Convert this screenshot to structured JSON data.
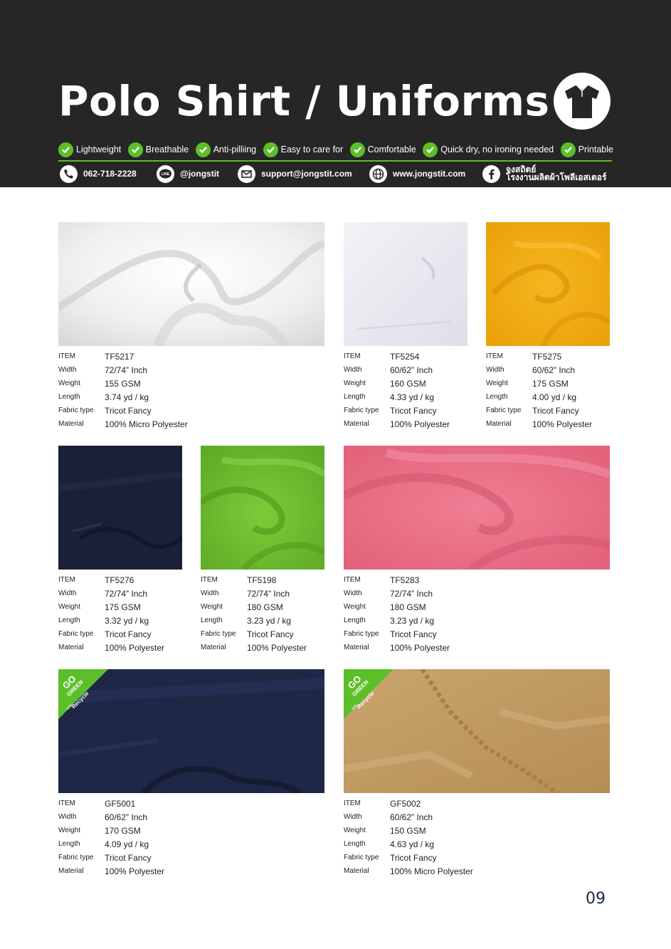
{
  "header": {
    "title": "Polo Shirt / Uniforms",
    "icon": "polo-shirt-icon",
    "features": [
      {
        "label": "Lightweight",
        "icon": "check-icon"
      },
      {
        "label": "Breathable",
        "icon": "check-icon"
      },
      {
        "label": "Anti-pilliing",
        "icon": "check-icon"
      },
      {
        "label": "Easy to care for",
        "icon": "check-icon"
      },
      {
        "label": "Comfortable",
        "icon": "check-icon"
      },
      {
        "label": "Quick dry, no ironing needed",
        "icon": "check-icon"
      },
      {
        "label": "Printable",
        "icon": "check-icon"
      }
    ],
    "contacts": {
      "phone": "062-718-2228",
      "line": "@jongstit",
      "line_badge": "LINE",
      "email": "support@jongstit.com",
      "website": "www.jongstit.com",
      "facebook_line1": "จงสถิตย์",
      "facebook_line2": "โรงงานผลิตผ้าโพลีเอสเตอร์"
    }
  },
  "colors": {
    "header_bg": "#262626",
    "accent_green": "#5cbf2a",
    "page_number": "#1a2744"
  },
  "spec_labels": {
    "item": "ITEM",
    "width": "Width",
    "weight": "Weight",
    "length": "Length",
    "fabric_type": "Fabric type",
    "material": "Material"
  },
  "go_green_badge": {
    "go": "GO",
    "green": "GREEN",
    "with": "with",
    "recycle": "Recycle"
  },
  "products": [
    {
      "item": "TF5217",
      "width": "72/74” Inch",
      "weight": "155 GSM",
      "length": "3.74 yd / kg",
      "fabric_type": "Tricot Fancy",
      "material": "100% Micro Polyester",
      "color": "#ececec"
    },
    {
      "item": "TF5254",
      "width": "60/62” Inch",
      "weight": "160 GSM",
      "length": "4.33 yd / kg",
      "fabric_type": "Tricot Fancy",
      "material": "100% Polyester",
      "color": "#e6e6ee"
    },
    {
      "item": "TF5275",
      "width": "60/62” Inch",
      "weight": "175 GSM",
      "length": "4.00 yd / kg",
      "fabric_type": "Tricot Fancy",
      "material": "100% Polyester",
      "color": "#f4b016"
    },
    {
      "item": "TF5276",
      "width": "72/74” Inch",
      "weight": "175 GSM",
      "length": "3.32 yd / kg",
      "fabric_type": "Tricot Fancy",
      "material": "100% Polyester",
      "color": "#1a2038"
    },
    {
      "item": "TF5198",
      "width": "72/74” Inch",
      "weight": "180 GSM",
      "length": "3.23 yd / kg",
      "fabric_type": "Tricot Fancy",
      "material": "100% Polyester",
      "color": "#6fbc2f"
    },
    {
      "item": "TF5283",
      "width": "72/74” Inch",
      "weight": "180 GSM",
      "length": "3.23 yd / kg",
      "fabric_type": "Tricot Fancy",
      "material": "100% Polyester",
      "color": "#ea7086"
    },
    {
      "item": "GF5001",
      "width": "60/62” Inch",
      "weight": "170 GSM",
      "length": "4.09 yd / kg",
      "fabric_type": "Tricot Fancy",
      "material": "100% Polyester",
      "color": "#1f2747",
      "badge": "go-green-recycle"
    },
    {
      "item": "GF5002",
      "width": "60/62” Inch",
      "weight": "150 GSM",
      "length": "4.63 yd / kg",
      "fabric_type": "Tricot Fancy",
      "material": "100% Micro Polyester",
      "color": "#c09a63",
      "badge": "go-green-recycle"
    }
  ],
  "page_number": "09"
}
